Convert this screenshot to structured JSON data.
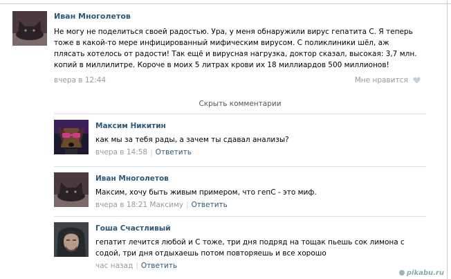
{
  "post": {
    "author": "Иван Многолетов",
    "text": "Не могу не поделиться своей радостью. Ура, у меня обнаружили вирус гепатита С. Я теперь тоже в какой-то мере инфицированный мифическим вирусом. С поликлиники шёл, аж плясать хотелось от радости! Так ещё и вирусная нагрузка, доктор сказал, высокая: 3,7 млн. копий в миллилитре. Короче в моих 5 литрах крови их 18 миллиардов 500 миллионов!",
    "time": "вчера в 12:44",
    "like_label": "Мне нравится"
  },
  "hide_comments_label": "Скрыть комментарии",
  "comments": [
    {
      "author": "Максим Никитин",
      "text": "как мы за тебя рады, а зачем ты сдавал анализы?",
      "time": "вчера в 14:58",
      "reply_to": "",
      "reply_label": "Ответить"
    },
    {
      "author": "Иван Многолетов",
      "text": "Максим, хочу быть живым примером, что гепС - это миф.",
      "time": "вчера в 18:21",
      "reply_to": "Максиму",
      "reply_label": "Ответить"
    },
    {
      "author": "Гоша Счастливый",
      "text": "гепатит лечится любой и С тоже, три дня подряд на тощак пьешь сок лимона с содой, три дня отдыхаешь потом повторяешь и все хорошо",
      "time": "час назад",
      "reply_to": "",
      "reply_label": "Ответить"
    }
  ],
  "watermark": "pikabu.ru",
  "colors": {
    "link": "#2b587a",
    "meta": "#999999",
    "divider": "#dae1e8"
  },
  "icons": [
    "heart-icon",
    "avatar-cat",
    "avatar-dog-glasses",
    "avatar-hooded-man"
  ]
}
